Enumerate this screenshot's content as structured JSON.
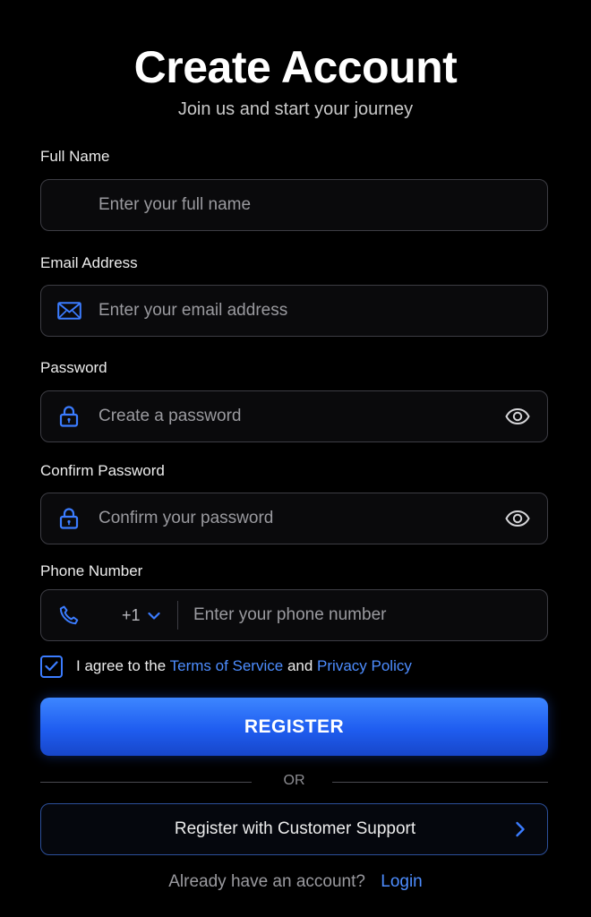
{
  "header": {
    "title": "Create Account",
    "subtitle": "Join us and start your journey"
  },
  "form": {
    "full_name": {
      "label": "Full Name",
      "placeholder": "Enter your full name"
    },
    "email": {
      "label": "Email Address",
      "placeholder": "Enter your email address",
      "icon": "envelope-icon"
    },
    "password": {
      "label": "Password",
      "placeholder": "Create a password",
      "icon": "lock-icon",
      "toggle_icon": "eye-icon"
    },
    "confirm_password": {
      "label": "Confirm Password",
      "placeholder": "Confirm your password",
      "icon": "lock-icon",
      "toggle_icon": "eye-icon"
    },
    "phone": {
      "label": "Phone Number",
      "country_code": "+1",
      "placeholder": "Enter your phone number",
      "icon": "phone-icon"
    }
  },
  "agreement": {
    "checked": true,
    "prefix": "I agree to the",
    "terms_link": "Terms of Service",
    "conjunction": "and",
    "privacy_link": "Privacy Policy"
  },
  "actions": {
    "register_label": "REGISTER",
    "or_label": "OR",
    "support_label": "Register with Customer Support"
  },
  "footer": {
    "prompt": "Already have an account?",
    "login_label": "Login"
  },
  "colors": {
    "background": "#000000",
    "accent": "#3b7cff",
    "link": "#4d8dff",
    "field_border": "#3d3d44"
  }
}
